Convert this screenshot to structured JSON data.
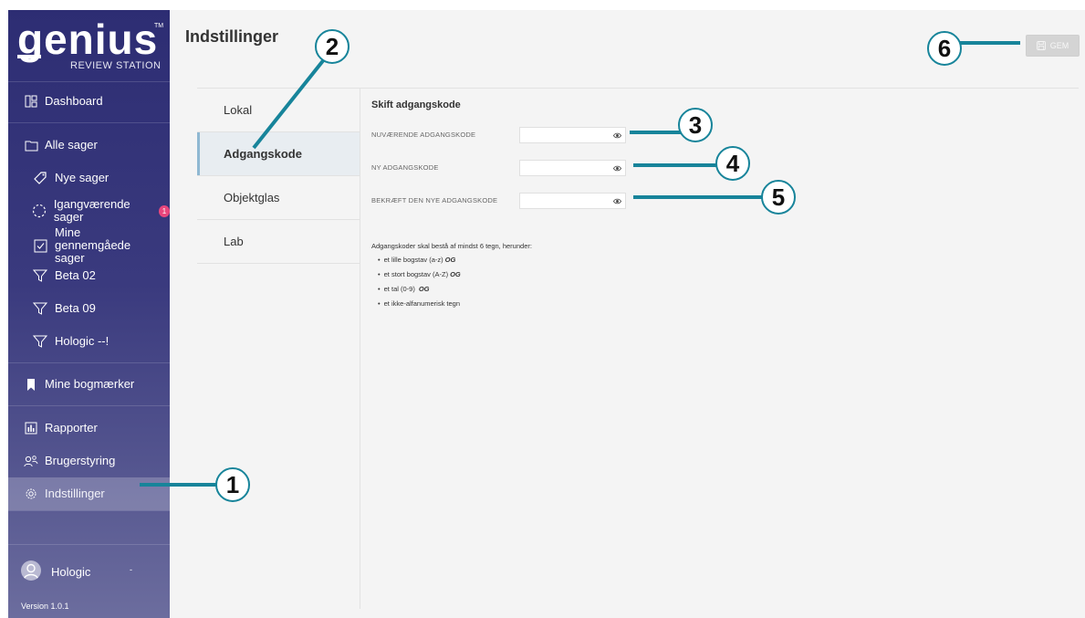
{
  "sidebar": {
    "logo_text": "genius",
    "logo_tm": "TM",
    "logo_subtitle": "REVIEW STATION",
    "items": [
      {
        "label": "Dashboard",
        "icon": "dashboard-icon"
      },
      {
        "label": "Alle sager",
        "icon": "folder-icon"
      },
      {
        "label": "Nye sager",
        "icon": "tag-icon"
      },
      {
        "label": "Igangværende sager",
        "icon": "progress-icon",
        "badge": "1"
      },
      {
        "label": "Mine gennemgåede sager",
        "icon": "checkbox-icon"
      },
      {
        "label": "Beta 02",
        "icon": "filter-icon"
      },
      {
        "label": "Beta 09",
        "icon": "filter-icon"
      },
      {
        "label": "Hologic --!",
        "icon": "filter-icon"
      },
      {
        "label": "Mine bogmærker",
        "icon": "bookmark-icon"
      },
      {
        "label": "Rapporter",
        "icon": "report-icon"
      },
      {
        "label": "Brugerstyring",
        "icon": "users-icon"
      },
      {
        "label": "Indstillinger",
        "icon": "gear-icon"
      }
    ],
    "user_name": "Hologic",
    "user_caret": "-",
    "version": "Version 1.0.1"
  },
  "header": {
    "title": "Indstillinger",
    "save_label": "GEM"
  },
  "subnav": {
    "items": [
      "Lokal",
      "Adgangskode",
      "Objektglas",
      "Lab"
    ]
  },
  "form": {
    "title": "Skift adgangskode",
    "current_label": "NUVÆRENDE ADGANGSKODE",
    "new_label": "NY ADGANGSKODE",
    "confirm_label": "BEKRÆFT DEN NYE ADGANGSKODE",
    "rules_intro": "Adgangskoder skal bestå af mindst 6 tegn, herunder:",
    "rules": [
      {
        "text": "et lille bogstav (a-z)",
        "og": "OG"
      },
      {
        "text": "et stort bogstav (A-Z)",
        "og": "OG"
      },
      {
        "text": "et tal (0-9)",
        "og": "OG"
      },
      {
        "text": "et ikke-alfanumerisk tegn",
        "og": ""
      }
    ]
  },
  "callouts": [
    "1",
    "2",
    "3",
    "4",
    "5",
    "6"
  ],
  "colors": {
    "sidebar_top": "#2d2d73",
    "sidebar_bottom": "#6c6d9e",
    "callout": "#17849a",
    "badge": "#e8467c",
    "active_tab_marker": "#8fb8d2"
  }
}
